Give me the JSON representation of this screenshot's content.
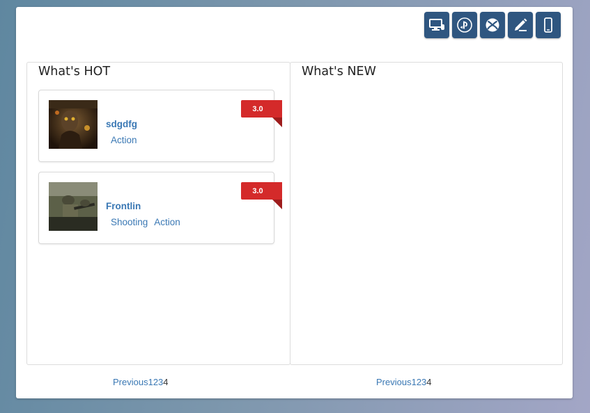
{
  "platforms": [
    {
      "icon": "desktop-icon",
      "label": "PC"
    },
    {
      "icon": "playstation-icon",
      "label": "PlayStation"
    },
    {
      "icon": "xbox-icon",
      "label": "Xbox"
    },
    {
      "icon": "pen-tablet-icon",
      "label": "Tablet"
    },
    {
      "icon": "mobile-icon",
      "label": "Mobile"
    }
  ],
  "hot": {
    "title": "What's HOT",
    "games": [
      {
        "name": "sdgdfg",
        "genres": [
          "Action"
        ],
        "rating": "3.0"
      },
      {
        "name": "Frontlin",
        "genres": [
          "Shooting",
          "Action"
        ],
        "rating": "3.0"
      }
    ],
    "pager": {
      "previous": "Previous",
      "pages": [
        "1",
        "2",
        "3",
        "4"
      ],
      "current": "4"
    }
  },
  "new": {
    "title": "What's NEW",
    "pager": {
      "previous": "Previous",
      "pages": [
        "1",
        "2",
        "3",
        "4"
      ],
      "current": "4"
    }
  },
  "colors": {
    "accent": "#3a78b4",
    "platform_button": "#2f5680",
    "rating_badge": "#d42a2a"
  }
}
